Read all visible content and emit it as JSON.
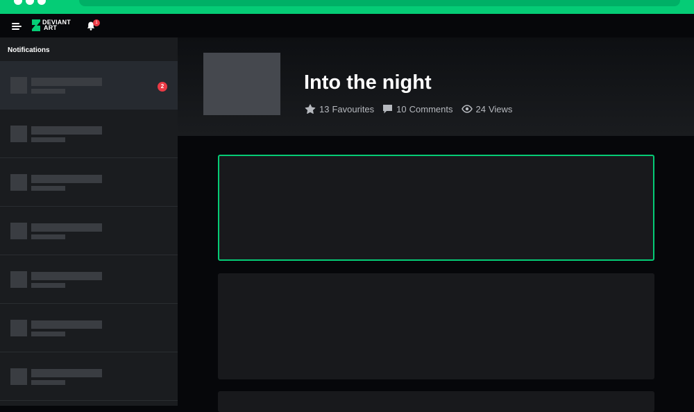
{
  "header": {
    "logo_text": "DEVIANT\nART",
    "notification_count": "1"
  },
  "sidebar": {
    "title": "Notifications",
    "items": [
      {
        "badge": "2",
        "active": true
      },
      {
        "badge": ""
      },
      {
        "badge": ""
      },
      {
        "badge": ""
      },
      {
        "badge": ""
      },
      {
        "badge": ""
      },
      {
        "badge": ""
      }
    ]
  },
  "deviation": {
    "title": "Into the night",
    "favourites_count": "13",
    "favourites_label": "Favourites",
    "comments_count": "10",
    "comments_label": "Comments",
    "views_count": "24",
    "views_label": "Views"
  },
  "colors": {
    "brand": "#05cc76",
    "badge": "#ea3a45"
  }
}
